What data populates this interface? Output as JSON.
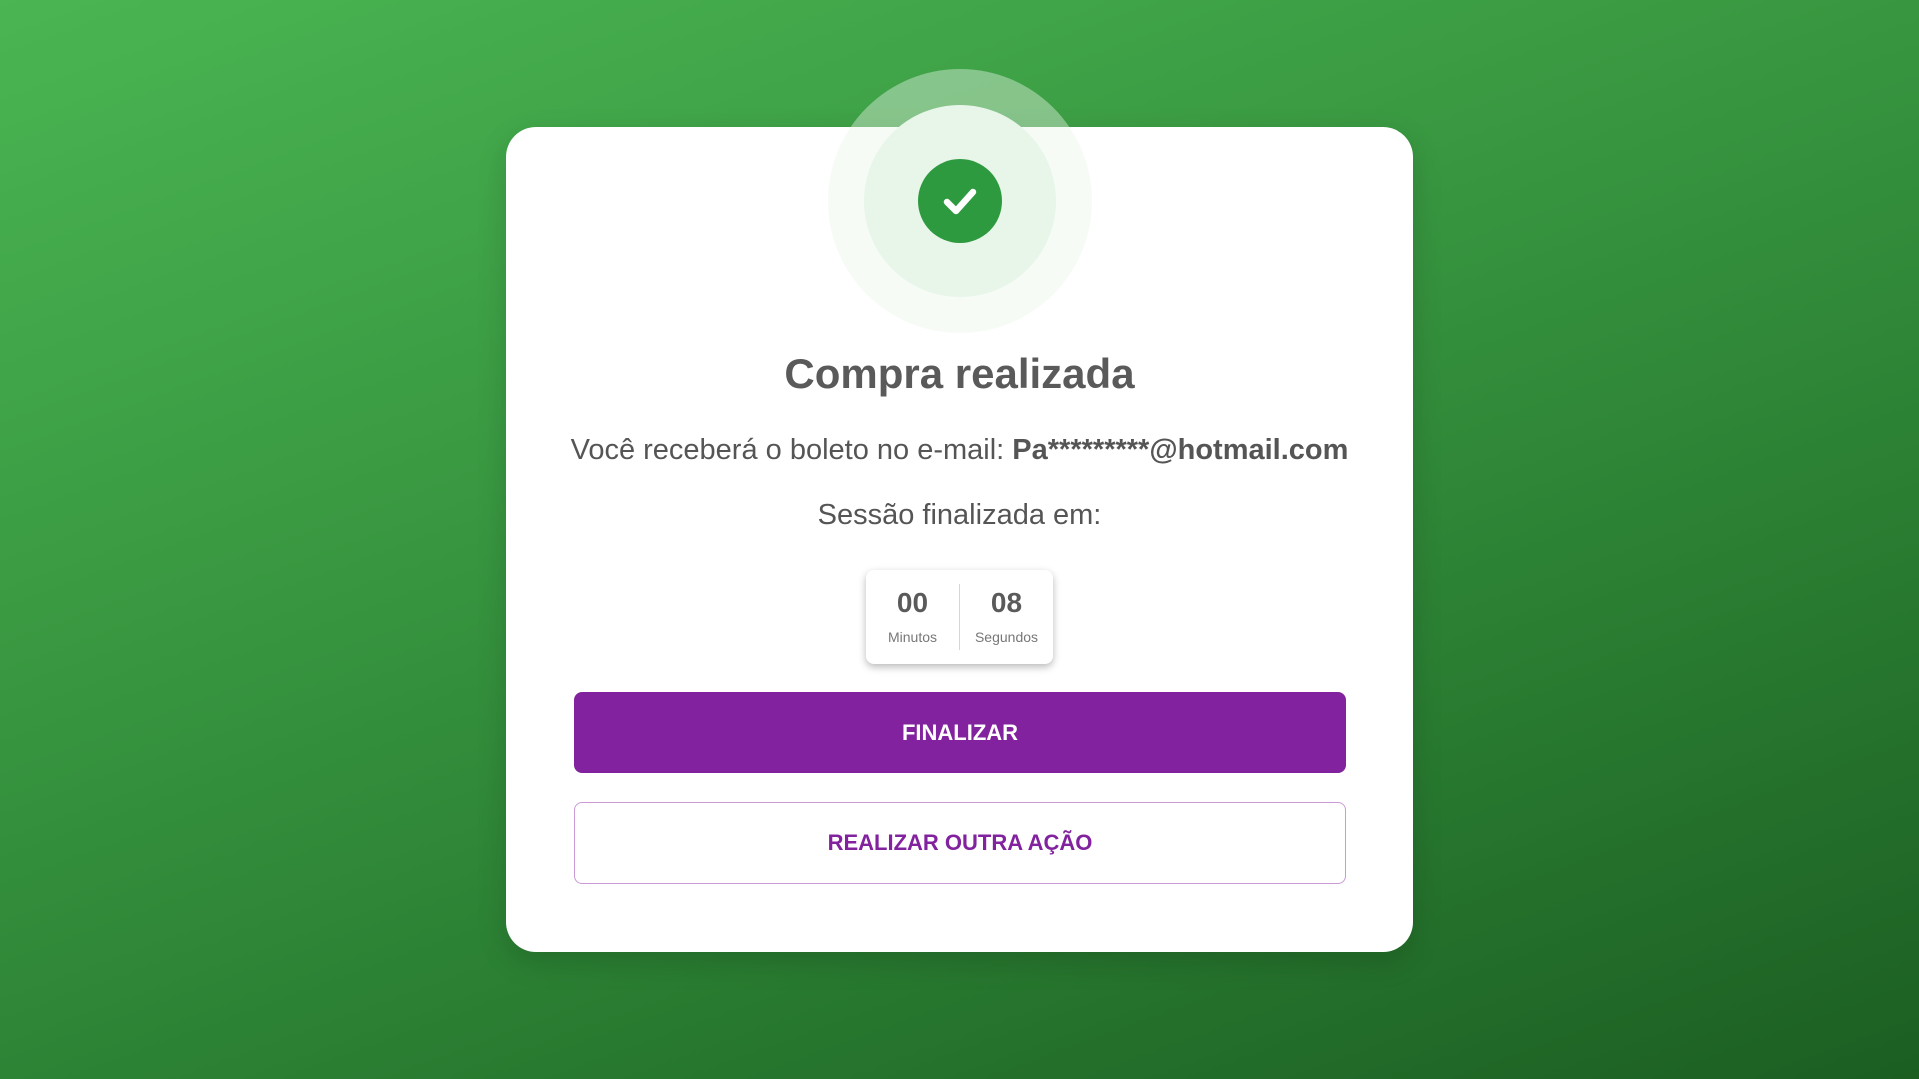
{
  "header": {
    "title": "Compra realizada"
  },
  "message": {
    "email_prefix": "Você receberá o boleto no e-mail: ",
    "email": "Pa*********@hotmail.com",
    "session_text": "Sessão finalizada em:"
  },
  "timer": {
    "minutes": "00",
    "minutes_label": "Minutos",
    "seconds": "08",
    "seconds_label": "Segundos"
  },
  "actions": {
    "primary_label": "FINALIZAR",
    "secondary_label": "REALIZAR OUTRA AÇÃO"
  },
  "icons": {
    "success": "check-icon"
  },
  "colors": {
    "success_green": "#2e9a40",
    "brand_purple": "#82229f",
    "background_green": "#3a9a42"
  }
}
